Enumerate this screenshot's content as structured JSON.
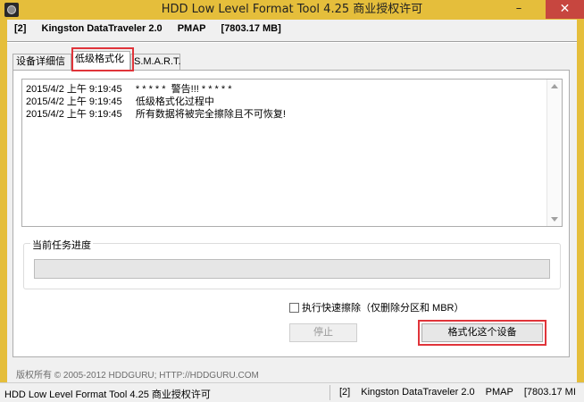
{
  "window": {
    "title": "HDD Low Level Format Tool 4.25   商业授权许可",
    "minimize": "–",
    "close": "✕",
    "icon": "hdd-icon"
  },
  "device": {
    "index": "[2]",
    "name": "Kingston DataTraveler 2.0",
    "mode": "PMAP",
    "size": "[7803.17 MB]"
  },
  "tabs": [
    {
      "label": "设备详细信息"
    },
    {
      "label": "低级格式化"
    },
    {
      "label": "S.M.A.R.T."
    }
  ],
  "log": [
    {
      "text": "2015/4/2 上午 9:19:45     * * * * *  警告!!! * * * * *"
    },
    {
      "text": "2015/4/2 上午 9:19:45     低级格式化过程中"
    },
    {
      "text": "2015/4/2 上午 9:19:45     所有数据将被完全擦除且不可恢复!"
    }
  ],
  "progress": {
    "title": "当前任务进度",
    "value": 0
  },
  "quick_wipe": {
    "label": "执行快速擦除（仅删除分区和 MBR）",
    "checked": false
  },
  "buttons": {
    "stop": "停止",
    "format": "格式化这个设备"
  },
  "copyright": "版权所有 © 2005-2012 HDDGURU;  HTTP://HDDGURU.COM",
  "status": {
    "app": "HDD Low Level Format Tool 4.25     商业授权许可",
    "device_index": "[2]",
    "device_name": "Kingston DataTraveler 2.0",
    "device_mode": "PMAP",
    "device_size": "[7803.17 MI"
  },
  "colors": {
    "titlebar": "#e5be3b",
    "close": "#c7463f",
    "highlight": "#e0343a"
  }
}
